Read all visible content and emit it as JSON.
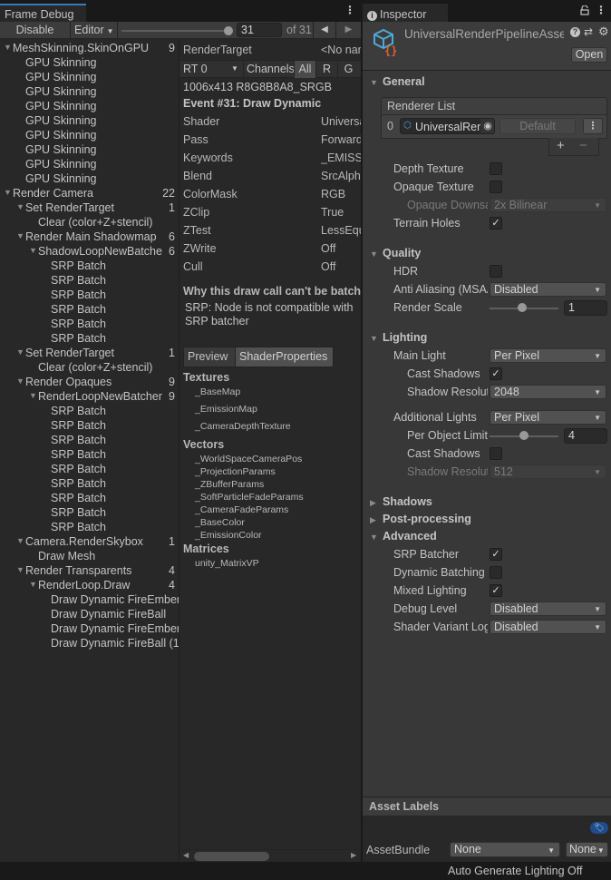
{
  "frame_debug": {
    "tab_title": "Frame Debug",
    "toolbar": {
      "disable_label": "Disable",
      "target_label": "Editor",
      "event_slider_value": 31,
      "event_field": "31",
      "of_total": "of 31",
      "prev_icon": "arrow-left-icon",
      "next_icon": "arrow-right-icon"
    },
    "tree": [
      {
        "label": "MeshSkinning.SkinOnGPU",
        "count": "9",
        "depth": 0,
        "expanded": true
      },
      {
        "label": "GPU Skinning",
        "count": "",
        "depth": 2
      },
      {
        "label": "GPU Skinning",
        "count": "",
        "depth": 2
      },
      {
        "label": "GPU Skinning",
        "count": "",
        "depth": 2
      },
      {
        "label": "GPU Skinning",
        "count": "",
        "depth": 2
      },
      {
        "label": "GPU Skinning",
        "count": "",
        "depth": 2
      },
      {
        "label": "GPU Skinning",
        "count": "",
        "depth": 2
      },
      {
        "label": "GPU Skinning",
        "count": "",
        "depth": 2
      },
      {
        "label": "GPU Skinning",
        "count": "",
        "depth": 2
      },
      {
        "label": "GPU Skinning",
        "count": "",
        "depth": 2
      },
      {
        "label": "Render Camera",
        "count": "22",
        "depth": 0,
        "expanded": true
      },
      {
        "label": "Set RenderTarget",
        "count": "1",
        "depth": 1,
        "expanded": true
      },
      {
        "label": "Clear (color+Z+stencil)",
        "count": "",
        "depth": 3
      },
      {
        "label": "Render Main Shadowmap",
        "count": "6",
        "depth": 1,
        "expanded": true
      },
      {
        "label": "ShadowLoopNewBatcher",
        "count": "6",
        "depth": 2,
        "expanded": true
      },
      {
        "label": "SRP Batch",
        "count": "",
        "depth": 4
      },
      {
        "label": "SRP Batch",
        "count": "",
        "depth": 4
      },
      {
        "label": "SRP Batch",
        "count": "",
        "depth": 4
      },
      {
        "label": "SRP Batch",
        "count": "",
        "depth": 4
      },
      {
        "label": "SRP Batch",
        "count": "",
        "depth": 4
      },
      {
        "label": "SRP Batch",
        "count": "",
        "depth": 4
      },
      {
        "label": "Set RenderTarget",
        "count": "1",
        "depth": 1,
        "expanded": true
      },
      {
        "label": "Clear (color+Z+stencil)",
        "count": "",
        "depth": 3
      },
      {
        "label": "Render Opaques",
        "count": "9",
        "depth": 1,
        "expanded": true
      },
      {
        "label": "RenderLoopNewBatcher.",
        "count": "9",
        "depth": 2,
        "expanded": true
      },
      {
        "label": "SRP Batch",
        "count": "",
        "depth": 4
      },
      {
        "label": "SRP Batch",
        "count": "",
        "depth": 4
      },
      {
        "label": "SRP Batch",
        "count": "",
        "depth": 4
      },
      {
        "label": "SRP Batch",
        "count": "",
        "depth": 4
      },
      {
        "label": "SRP Batch",
        "count": "",
        "depth": 4
      },
      {
        "label": "SRP Batch",
        "count": "",
        "depth": 4
      },
      {
        "label": "SRP Batch",
        "count": "",
        "depth": 4
      },
      {
        "label": "SRP Batch",
        "count": "",
        "depth": 4
      },
      {
        "label": "SRP Batch",
        "count": "",
        "depth": 4
      },
      {
        "label": "Camera.RenderSkybox",
        "count": "1",
        "depth": 1,
        "expanded": true
      },
      {
        "label": "Draw Mesh",
        "count": "",
        "depth": 3
      },
      {
        "label": "Render Transparents",
        "count": "4",
        "depth": 1,
        "expanded": true
      },
      {
        "label": "RenderLoop.Draw",
        "count": "4",
        "depth": 2,
        "expanded": true
      },
      {
        "label": "Draw Dynamic FireEmber",
        "count": "",
        "depth": 4
      },
      {
        "label": "Draw Dynamic FireBall",
        "count": "",
        "depth": 4
      },
      {
        "label": "Draw Dynamic FireEmber",
        "count": "",
        "depth": 4
      },
      {
        "label": "Draw Dynamic FireBall (1",
        "count": "",
        "depth": 4
      }
    ],
    "details": {
      "render_target_label": "RenderTarget",
      "render_target_value": "<No name>",
      "rt_select": "RT 0",
      "channels_label": "Channels",
      "channels": [
        "All",
        "R",
        "G"
      ],
      "format": "1006x413 R8G8B8A8_SRGB",
      "event_title": "Event #31: Draw Dynamic",
      "properties": [
        {
          "key": "Shader",
          "value": "Universal"
        },
        {
          "key": "Pass",
          "value": "Forward"
        },
        {
          "key": "Keywords",
          "value": "_EMISSION"
        },
        {
          "key": "Blend",
          "value": "SrcAlpha"
        },
        {
          "key": "ColorMask",
          "value": "RGB"
        },
        {
          "key": "ZClip",
          "value": "True"
        },
        {
          "key": "ZTest",
          "value": "LessEqual"
        },
        {
          "key": "ZWrite",
          "value": "Off"
        },
        {
          "key": "Cull",
          "value": "Off"
        }
      ],
      "batch_reason_title": "Why this draw call can't be batched",
      "batch_reason": "SRP: Node is not compatible with SRP batcher",
      "tabs": [
        "Preview",
        "ShaderProperties"
      ],
      "textures_header": "Textures",
      "textures": [
        "_BaseMap",
        "_EmissionMap",
        "_CameraDepthTexture"
      ],
      "vectors_header": "Vectors",
      "vectors": [
        "_WorldSpaceCameraPos",
        "_ProjectionParams",
        "_ZBufferParams",
        "_SoftParticleFadeParams",
        "_CameraFadeParams",
        "_BaseColor",
        "_EmissionColor"
      ],
      "matrices_header": "Matrices",
      "matrices": [
        "unity_MatrixVP"
      ]
    }
  },
  "inspector": {
    "tab_title": "Inspector",
    "asset_name": "UniversalRenderPipelineAsset",
    "open_label": "Open",
    "general": {
      "title": "General",
      "renderer_list_label": "Renderer List",
      "renderer_index": "0",
      "renderer_name": "UniversalRenderer",
      "default_label": "Default",
      "depth_texture_label": "Depth Texture",
      "depth_texture": false,
      "opaque_texture_label": "Opaque Texture",
      "opaque_texture": false,
      "opaque_downsampling_label": "Opaque Downsampling",
      "opaque_downsampling": "2x Bilinear",
      "terrain_holes_label": "Terrain Holes",
      "terrain_holes": true
    },
    "quality": {
      "title": "Quality",
      "hdr_label": "HDR",
      "hdr": false,
      "msaa_label": "Anti Aliasing (MSAA)",
      "msaa": "Disabled",
      "render_scale_label": "Render Scale",
      "render_scale": "1"
    },
    "lighting": {
      "title": "Lighting",
      "main_light_label": "Main Light",
      "main_light": "Per Pixel",
      "main_cast_shadows_label": "Cast Shadows",
      "main_cast_shadows": true,
      "main_shadow_res_label": "Shadow Resolution",
      "main_shadow_res": "2048",
      "additional_lights_label": "Additional Lights",
      "additional_lights": "Per Pixel",
      "per_object_limit_label": "Per Object Limit",
      "per_object_limit": "4",
      "add_cast_shadows_label": "Cast Shadows",
      "add_cast_shadows": false,
      "add_shadow_res_label": "Shadow Resolution",
      "add_shadow_res": "512"
    },
    "shadows": {
      "title": "Shadows"
    },
    "post_processing": {
      "title": "Post-processing"
    },
    "advanced": {
      "title": "Advanced",
      "srp_batcher_label": "SRP Batcher",
      "srp_batcher": true,
      "dynamic_batching_label": "Dynamic Batching",
      "dynamic_batching": false,
      "mixed_lighting_label": "Mixed Lighting",
      "mixed_lighting": true,
      "debug_level_label": "Debug Level",
      "debug_level": "Disabled",
      "shader_variant_label": "Shader Variant Log Level",
      "shader_variant": "Disabled"
    },
    "asset_labels_title": "Asset Labels",
    "asset_bundle_label": "AssetBundle",
    "asset_bundle_value": "None",
    "asset_bundle_variant": "None"
  },
  "status_bar": {
    "text": "Auto Generate Lighting Off"
  },
  "colors": {
    "accent_blue": "#3a79bb",
    "asset_icon_blue": "#4fa8d8",
    "asset_icon_orange": "#e0602f",
    "label_tag_blue": "#1e4d8c"
  }
}
